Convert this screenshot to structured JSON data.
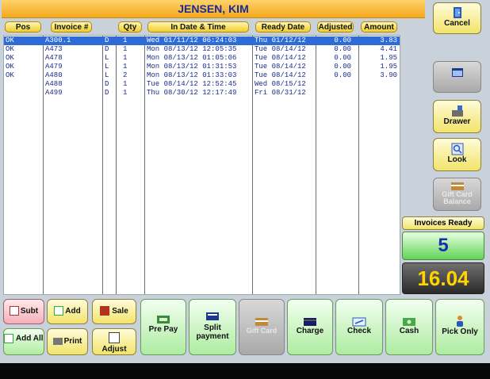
{
  "header": {
    "customer_name": "JENSEN, KIM"
  },
  "table": {
    "columns": [
      "Pos",
      "Invoice #",
      "Qty",
      "In Date & Time",
      "Ready Date",
      "Adjusted",
      "Amount"
    ],
    "rows": [
      {
        "pos": "OK",
        "invoice": "A300.1",
        "type": "D",
        "qty": "1",
        "in_date": "Wed 01/11/12 06:24:03",
        "ready": "Thu 01/12/12",
        "adjusted": "0.00",
        "amount": "3.83",
        "selected": true
      },
      {
        "pos": "OK",
        "invoice": "A473",
        "type": "D",
        "qty": "1",
        "in_date": "Mon 08/13/12 12:05:35",
        "ready": "Tue 08/14/12",
        "adjusted": "0.00",
        "amount": "4.41",
        "selected": false
      },
      {
        "pos": "OK",
        "invoice": "A478",
        "type": "L",
        "qty": "1",
        "in_date": "Mon 08/13/12 01:05:06",
        "ready": "Tue 08/14/12",
        "adjusted": "0.00",
        "amount": "1.95",
        "selected": false
      },
      {
        "pos": "OK",
        "invoice": "A479",
        "type": "L",
        "qty": "1",
        "in_date": "Mon 08/13/12 01:31:53",
        "ready": "Tue 08/14/12",
        "adjusted": "0.00",
        "amount": "1.95",
        "selected": false
      },
      {
        "pos": "OK",
        "invoice": "A480",
        "type": "L",
        "qty": "2",
        "in_date": "Mon 08/13/12 01:33:03",
        "ready": "Tue 08/14/12",
        "adjusted": "0.00",
        "amount": "3.90",
        "selected": false
      },
      {
        "pos": "",
        "invoice": "A488",
        "type": "D",
        "qty": "1",
        "in_date": "Tue 08/14/12 12:52:45",
        "ready": "Wed 08/15/12",
        "adjusted": "",
        "amount": "",
        "selected": false
      },
      {
        "pos": "",
        "invoice": "A499",
        "type": "D",
        "qty": "1",
        "in_date": "Thu 08/30/12 12:17:49",
        "ready": "Fri 08/31/12",
        "adjusted": "",
        "amount": "",
        "selected": false
      }
    ]
  },
  "right_panel": {
    "cancel": "Cancel",
    "drawer": "Drawer",
    "look": "Look",
    "gift_card_balance": "Gift Card Balance",
    "invoices_ready_label": "Invoices Ready",
    "invoices_ready_count": "5",
    "total": "16.04"
  },
  "actions": {
    "subt": "Subt",
    "add": "Add",
    "sale": "Sale",
    "add_all": "Add All",
    "print": "Print",
    "adjust": "Adjust",
    "pre_pay": "Pre Pay",
    "split_payment": "Split payment",
    "gift_card": "Gift Card",
    "charge": "Charge",
    "check": "Check",
    "cash": "Cash",
    "pick_only": "Pick Only"
  },
  "colors": {
    "title_bg": "#f4a81d",
    "selected_row": "#2f6bd7",
    "total_bg": "#3a3a3a",
    "total_text": "#ffd400",
    "count_text": "#1a2fb0"
  }
}
